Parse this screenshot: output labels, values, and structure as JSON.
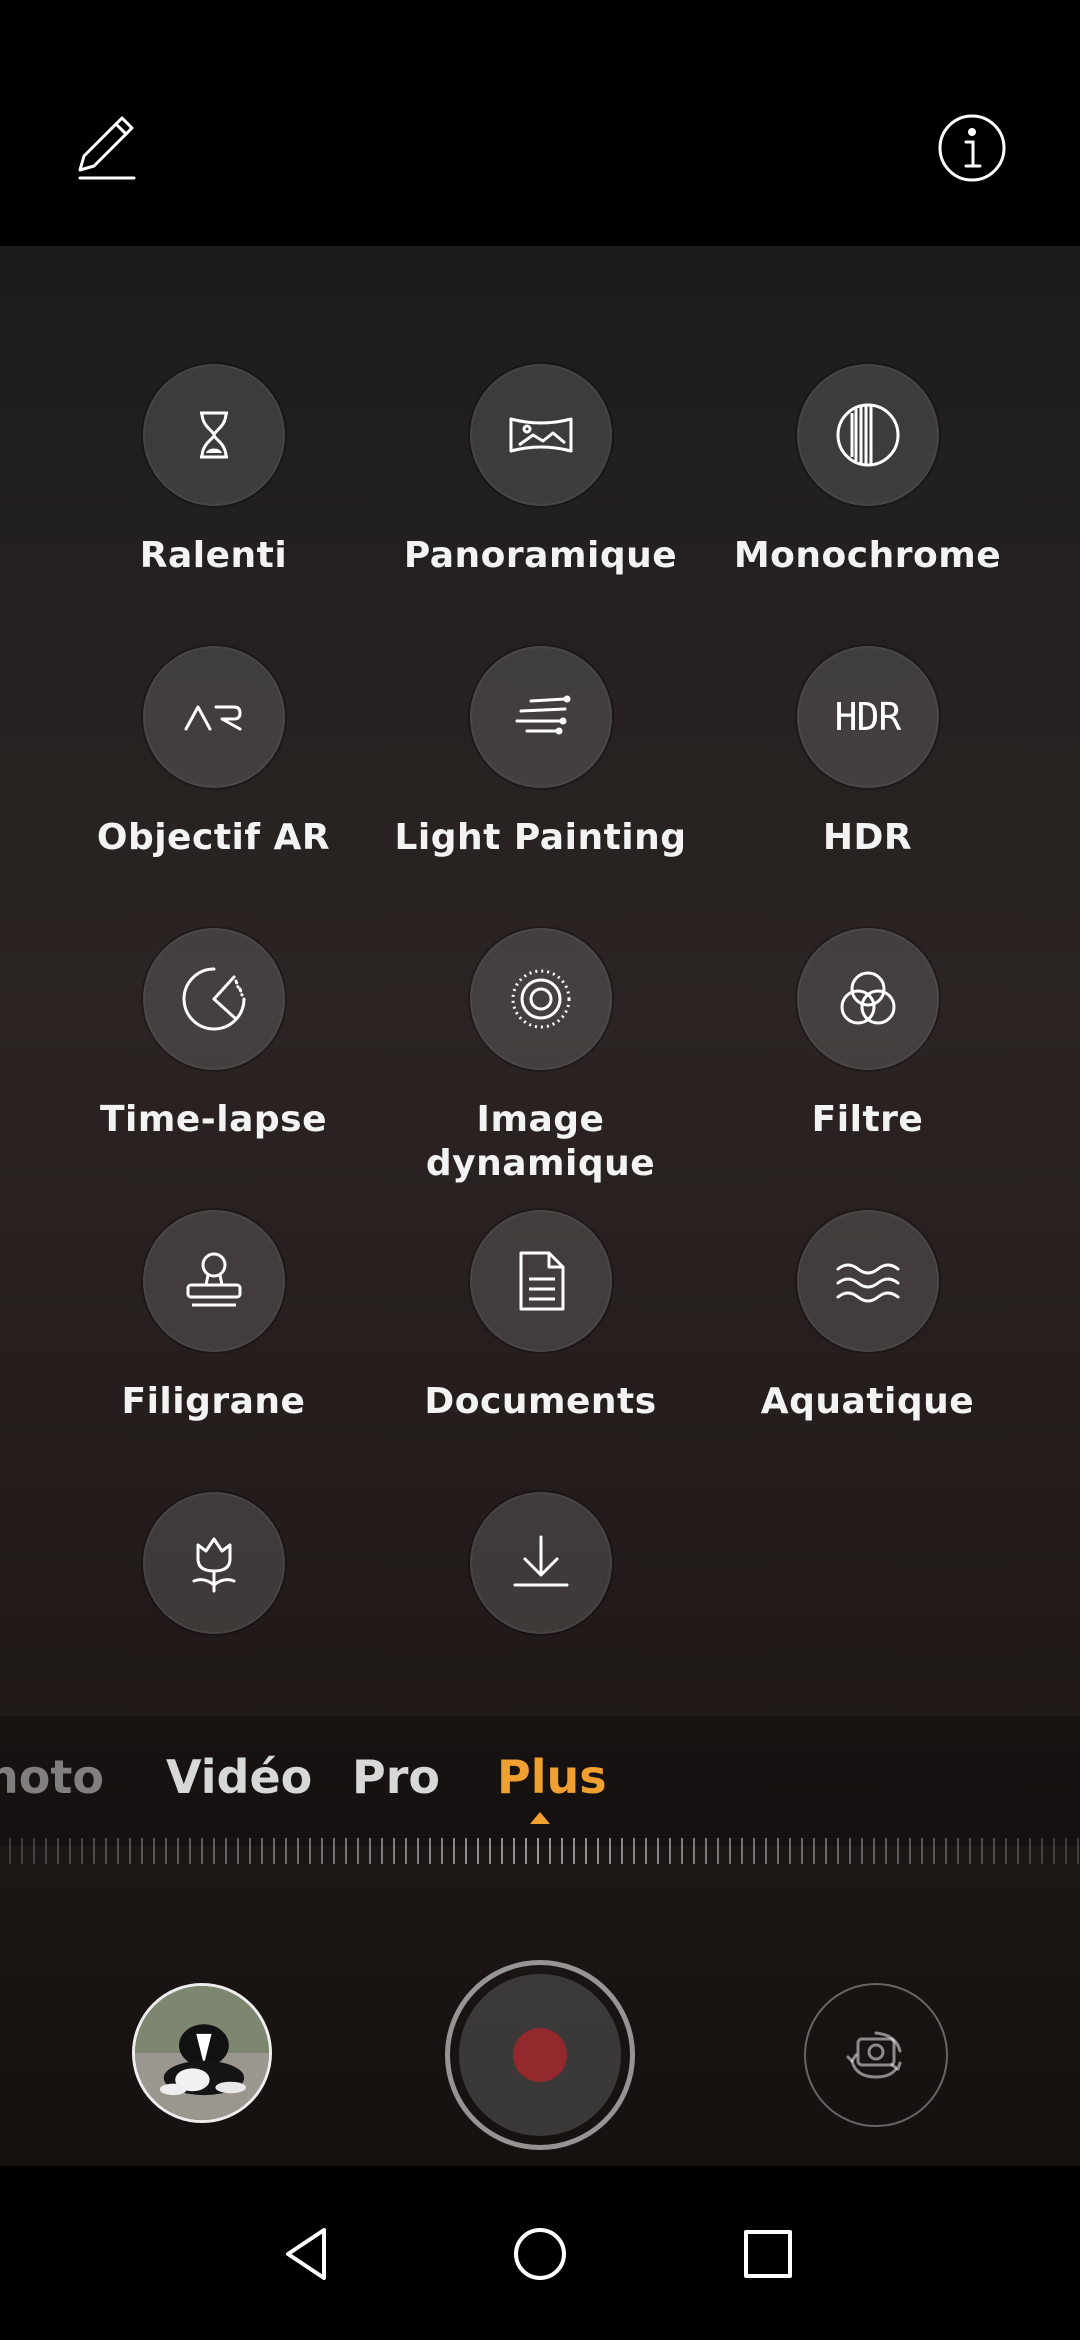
{
  "topbar": {
    "edit_icon": "pencil-icon",
    "info_icon": "info-icon"
  },
  "modes": [
    {
      "label": "Ralenti",
      "icon": "hourglass-icon"
    },
    {
      "label": "Panoramique",
      "icon": "panorama-icon"
    },
    {
      "label": "Monochrome",
      "icon": "monochrome-icon"
    },
    {
      "label": "Objectif AR",
      "icon": "ar-icon"
    },
    {
      "label": "Light Painting",
      "icon": "light-painting-icon"
    },
    {
      "label": "HDR",
      "icon": "hdr-icon",
      "icon_text": "HDR"
    },
    {
      "label": "Time-lapse",
      "icon": "timelapse-icon"
    },
    {
      "label": "Image\ndynamique",
      "icon": "moving-picture-icon"
    },
    {
      "label": "Filtre",
      "icon": "filter-icon"
    },
    {
      "label": "Filigrane",
      "icon": "watermark-stamp-icon"
    },
    {
      "label": "Documents",
      "icon": "document-icon"
    },
    {
      "label": "Aquatique",
      "icon": "underwater-waves-icon"
    },
    {
      "label": "",
      "icon": "flower-icon"
    },
    {
      "label": "",
      "icon": "download-icon"
    }
  ],
  "mode_tabs": [
    {
      "label": "hoto",
      "active": false
    },
    {
      "label": "Vidéo",
      "active": false
    },
    {
      "label": "Pro",
      "active": false
    },
    {
      "label": "Plus",
      "active": true
    }
  ],
  "controls": {
    "gallery_icon": "gallery-thumbnail",
    "shutter_icon": "record-button",
    "switch_icon": "switch-camera-icon"
  },
  "nav": {
    "back": "back-icon",
    "home": "home-icon",
    "recents": "recents-icon"
  },
  "colors": {
    "accent": "#f0a030",
    "record": "#a3262b"
  }
}
